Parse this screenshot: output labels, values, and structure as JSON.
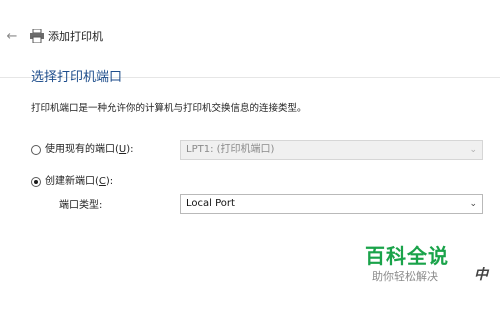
{
  "window": {
    "title": "添加打印机"
  },
  "page": {
    "heading": "选择打印机端口",
    "description": "打印机端口是一种允许你的计算机与打印机交换信息的连接类型。"
  },
  "option_existing": {
    "label_before": "使用现有的端口(",
    "hotkey": "U",
    "label_after": "):",
    "selected": false,
    "select_value": "LPT1: (打印机端口)"
  },
  "option_new": {
    "label_before": "创建新端口(",
    "hotkey": "C",
    "label_after": "):",
    "selected": true,
    "port_type_label": "端口类型:",
    "select_value": "Local Port"
  },
  "watermark": {
    "main": "百科全说",
    "sub": "助你轻松解决",
    "corner": "中"
  },
  "colors": {
    "heading": "#1f4e8c",
    "watermark": "#1aa34a"
  },
  "icons": {
    "back": "back-arrow-icon",
    "printer": "printer-icon",
    "dropdown": "chevron-down-icon"
  }
}
